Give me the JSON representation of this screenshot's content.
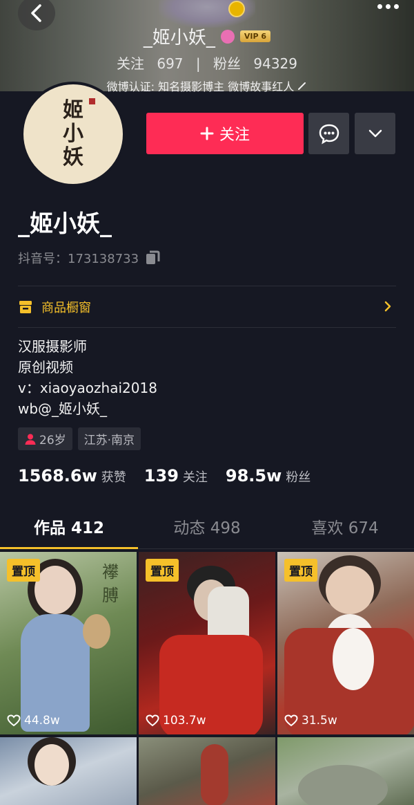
{
  "header": {
    "name": "_姬小妖_",
    "vip": "VIP 6",
    "following_label": "关注",
    "following_count": "697",
    "separator": "|",
    "fans_label": "粉丝",
    "fans_count": "94329",
    "certification": "微博认证: 知名摄影博主 微博故事红人"
  },
  "avatar": {
    "calligraphy": [
      "姬",
      "小",
      "妖"
    ]
  },
  "actions": {
    "follow_label": "关注"
  },
  "profile": {
    "username": "_姬小妖_",
    "douyin_id": "抖音号：173138733",
    "shop_label": "商品橱窗",
    "bio": [
      "汉服摄影师",
      "原创视频",
      "v：xiaoyaozhai2018",
      "wb@_姬小妖_"
    ],
    "tags": {
      "age": "26岁",
      "location": "江苏·南京"
    }
  },
  "stats": [
    {
      "num": "1568.6w",
      "label": "获赞"
    },
    {
      "num": "139",
      "label": "关注"
    },
    {
      "num": "98.5w",
      "label": "粉丝"
    }
  ],
  "tabs": [
    "作品 412",
    "动态 498",
    "喜欢 674"
  ],
  "grid": {
    "pin_label": "置顶",
    "items": [
      {
        "likes": "44.8w",
        "caption": "襻 膊"
      },
      {
        "likes": "103.7w"
      },
      {
        "likes": "31.5w"
      }
    ]
  },
  "colors": {
    "background": "#161823",
    "accent_red": "#fe2c55",
    "accent_yellow": "#f5c02a"
  }
}
